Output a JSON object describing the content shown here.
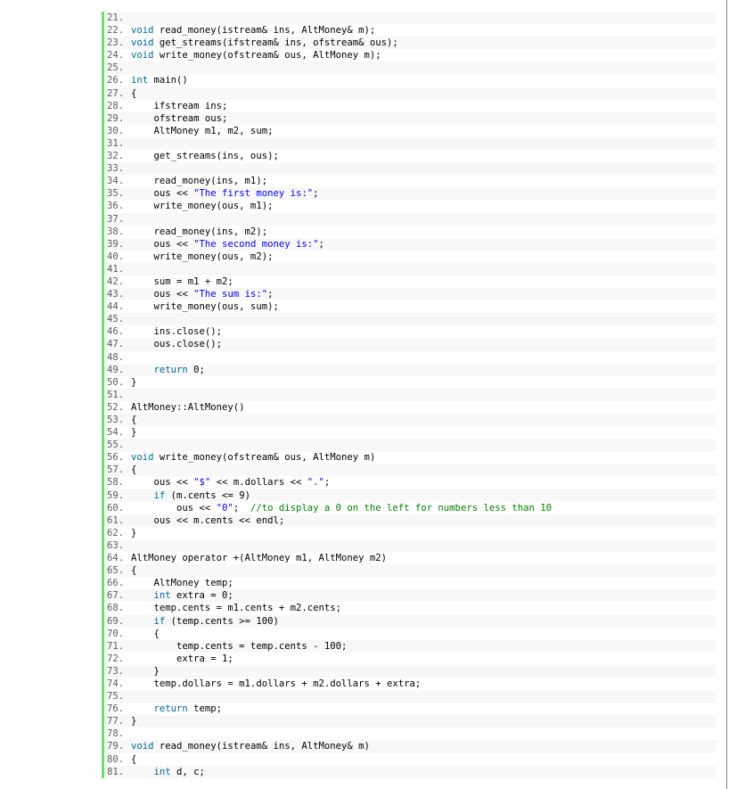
{
  "lines": [
    {
      "n": "21.",
      "tokens": []
    },
    {
      "n": "22.",
      "tokens": [
        [
          "kw",
          "void"
        ],
        [
          "tx",
          " read_money(istream& ins, AltMoney& m);"
        ]
      ]
    },
    {
      "n": "23.",
      "tokens": [
        [
          "kw",
          "void"
        ],
        [
          "tx",
          " get_streams(ifstream& ins, ofstream& ous);"
        ]
      ]
    },
    {
      "n": "24.",
      "tokens": [
        [
          "kw",
          "void"
        ],
        [
          "tx",
          " write_money(ofstream& ous, AltMoney m);"
        ]
      ]
    },
    {
      "n": "25.",
      "tokens": []
    },
    {
      "n": "26.",
      "tokens": [
        [
          "tp",
          "int"
        ],
        [
          "tx",
          " main()"
        ]
      ]
    },
    {
      "n": "27.",
      "tokens": [
        [
          "tx",
          "{"
        ]
      ]
    },
    {
      "n": "28.",
      "tokens": [
        [
          "tx",
          "    ifstream ins;"
        ]
      ]
    },
    {
      "n": "29.",
      "tokens": [
        [
          "tx",
          "    ofstream ous;"
        ]
      ]
    },
    {
      "n": "30.",
      "tokens": [
        [
          "tx",
          "    AltMoney m1, m2, sum;"
        ]
      ]
    },
    {
      "n": "31.",
      "tokens": []
    },
    {
      "n": "32.",
      "tokens": [
        [
          "tx",
          "    get_streams(ins, ous);"
        ]
      ]
    },
    {
      "n": "33.",
      "tokens": []
    },
    {
      "n": "34.",
      "tokens": [
        [
          "tx",
          "    read_money(ins, m1);"
        ]
      ]
    },
    {
      "n": "35.",
      "tokens": [
        [
          "tx",
          "    ous << "
        ],
        [
          "str",
          "\"The first money is:\""
        ],
        [
          "tx",
          ";"
        ]
      ]
    },
    {
      "n": "36.",
      "tokens": [
        [
          "tx",
          "    write_money(ous, m1);"
        ]
      ]
    },
    {
      "n": "37.",
      "tokens": []
    },
    {
      "n": "38.",
      "tokens": [
        [
          "tx",
          "    read_money(ins, m2);"
        ]
      ]
    },
    {
      "n": "39.",
      "tokens": [
        [
          "tx",
          "    ous << "
        ],
        [
          "str",
          "\"The second money is:\""
        ],
        [
          "tx",
          ";"
        ]
      ]
    },
    {
      "n": "40.",
      "tokens": [
        [
          "tx",
          "    write_money(ous, m2);"
        ]
      ]
    },
    {
      "n": "41.",
      "tokens": []
    },
    {
      "n": "42.",
      "tokens": [
        [
          "tx",
          "    sum = m1 + m2;"
        ]
      ]
    },
    {
      "n": "43.",
      "tokens": [
        [
          "tx",
          "    ous << "
        ],
        [
          "str",
          "\"The sum is:\""
        ],
        [
          "tx",
          ";"
        ]
      ]
    },
    {
      "n": "44.",
      "tokens": [
        [
          "tx",
          "    write_money(ous, sum);"
        ]
      ]
    },
    {
      "n": "45.",
      "tokens": []
    },
    {
      "n": "46.",
      "tokens": [
        [
          "tx",
          "    ins.close();"
        ]
      ]
    },
    {
      "n": "47.",
      "tokens": [
        [
          "tx",
          "    ous.close();"
        ]
      ]
    },
    {
      "n": "48.",
      "tokens": []
    },
    {
      "n": "49.",
      "tokens": [
        [
          "kw",
          "    return"
        ],
        [
          "tx",
          " 0;"
        ]
      ]
    },
    {
      "n": "50.",
      "tokens": [
        [
          "tx",
          "}"
        ]
      ]
    },
    {
      "n": "51.",
      "tokens": []
    },
    {
      "n": "52.",
      "tokens": [
        [
          "tx",
          "AltMoney::AltMoney()"
        ]
      ]
    },
    {
      "n": "53.",
      "tokens": [
        [
          "tx",
          "{"
        ]
      ]
    },
    {
      "n": "54.",
      "tokens": [
        [
          "tx",
          "}"
        ]
      ]
    },
    {
      "n": "55.",
      "tokens": []
    },
    {
      "n": "56.",
      "tokens": [
        [
          "kw",
          "void"
        ],
        [
          "tx",
          " write_money(ofstream& ous, AltMoney m)"
        ]
      ]
    },
    {
      "n": "57.",
      "tokens": [
        [
          "tx",
          "{"
        ]
      ]
    },
    {
      "n": "58.",
      "tokens": [
        [
          "tx",
          "    ous << "
        ],
        [
          "str",
          "\"$\""
        ],
        [
          "tx",
          " << m.dollars << "
        ],
        [
          "str",
          "\".\""
        ],
        [
          "tx",
          ";"
        ]
      ]
    },
    {
      "n": "59.",
      "tokens": [
        [
          "kw",
          "    if"
        ],
        [
          "tx",
          " (m.cents <= 9)"
        ]
      ]
    },
    {
      "n": "60.",
      "tokens": [
        [
          "tx",
          "        ous << "
        ],
        [
          "str",
          "\"0\""
        ],
        [
          "tx",
          ";  "
        ],
        [
          "cm",
          "//to display a 0 on the left for numbers less than 10"
        ]
      ]
    },
    {
      "n": "61.",
      "tokens": [
        [
          "tx",
          "    ous << m.cents << endl;"
        ]
      ]
    },
    {
      "n": "62.",
      "tokens": [
        [
          "tx",
          "}"
        ]
      ]
    },
    {
      "n": "63.",
      "tokens": []
    },
    {
      "n": "64.",
      "tokens": [
        [
          "tx",
          "AltMoney operator +(AltMoney m1, AltMoney m2)"
        ]
      ]
    },
    {
      "n": "65.",
      "tokens": [
        [
          "tx",
          "{"
        ]
      ]
    },
    {
      "n": "66.",
      "tokens": [
        [
          "tx",
          "    AltMoney temp;"
        ]
      ]
    },
    {
      "n": "67.",
      "tokens": [
        [
          "tp",
          "    int"
        ],
        [
          "tx",
          " extra = 0;"
        ]
      ]
    },
    {
      "n": "68.",
      "tokens": [
        [
          "tx",
          "    temp.cents = m1.cents + m2.cents;"
        ]
      ]
    },
    {
      "n": "69.",
      "tokens": [
        [
          "kw",
          "    if"
        ],
        [
          "tx",
          " (temp.cents >= 100)"
        ]
      ]
    },
    {
      "n": "70.",
      "tokens": [
        [
          "tx",
          "    {"
        ]
      ]
    },
    {
      "n": "71.",
      "tokens": [
        [
          "tx",
          "        temp.cents = temp.cents - 100;"
        ]
      ]
    },
    {
      "n": "72.",
      "tokens": [
        [
          "tx",
          "        extra = 1;"
        ]
      ]
    },
    {
      "n": "73.",
      "tokens": [
        [
          "tx",
          "    }"
        ]
      ]
    },
    {
      "n": "74.",
      "tokens": [
        [
          "tx",
          "    temp.dollars = m1.dollars + m2.dollars + extra;"
        ]
      ]
    },
    {
      "n": "75.",
      "tokens": []
    },
    {
      "n": "76.",
      "tokens": [
        [
          "kw",
          "    return"
        ],
        [
          "tx",
          " temp;"
        ]
      ]
    },
    {
      "n": "77.",
      "tokens": [
        [
          "tx",
          "}"
        ]
      ]
    },
    {
      "n": "78.",
      "tokens": []
    },
    {
      "n": "79.",
      "tokens": [
        [
          "kw",
          "void"
        ],
        [
          "tx",
          " read_money(istream& ins, AltMoney& m)"
        ]
      ]
    },
    {
      "n": "80.",
      "tokens": [
        [
          "tx",
          "{"
        ]
      ]
    },
    {
      "n": "81.",
      "tokens": [
        [
          "tp",
          "    int"
        ],
        [
          "tx",
          " d, c;"
        ]
      ]
    }
  ],
  "colors": {
    "gutter": "#6ce26c",
    "keyword": "#006699",
    "string": "#0000ff",
    "comment": "#008200",
    "line_number": "#5c5c5c"
  }
}
